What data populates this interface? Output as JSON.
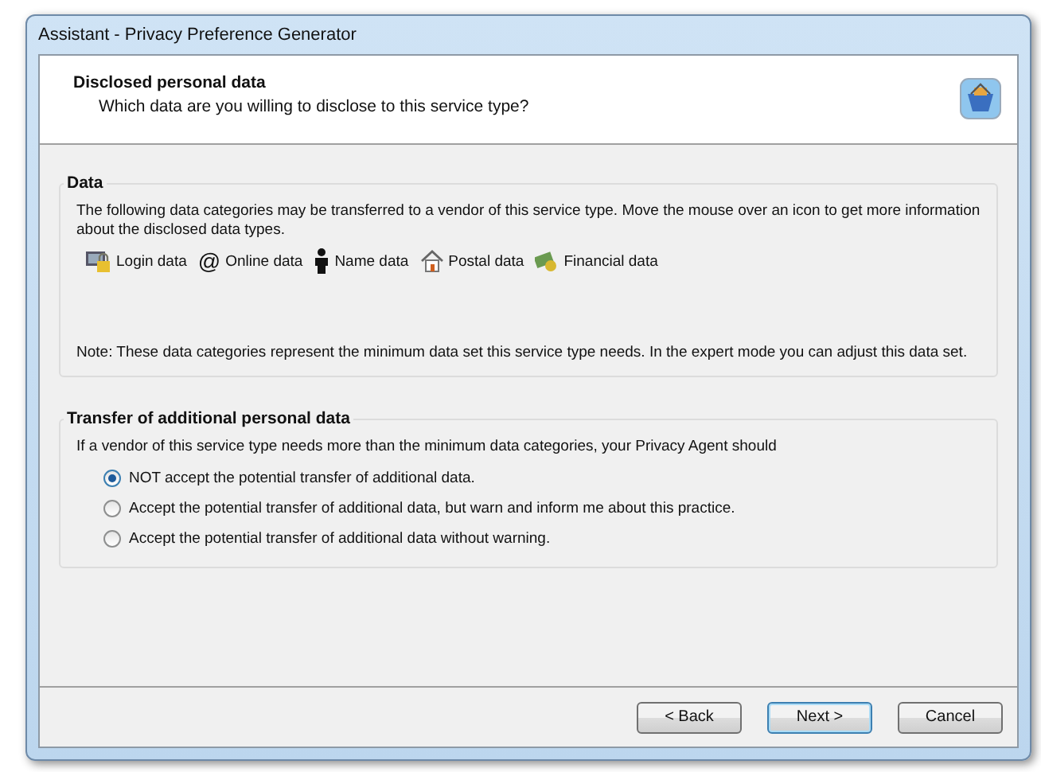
{
  "window": {
    "title": "Assistant - Privacy Preference Generator"
  },
  "header": {
    "title": "Disclosed personal data",
    "subtitle": "Which data are you willing to disclose to this service type?"
  },
  "data_group": {
    "title": "Data",
    "intro": "The following data categories may be transferred to a vendor of this service type. Move the mouse over an icon to get more information about the disclosed data types.",
    "categories": [
      {
        "kind": "login",
        "label": "Login data"
      },
      {
        "kind": "online",
        "symbol": "@",
        "label": "Online data"
      },
      {
        "kind": "name",
        "label": "Name data"
      },
      {
        "kind": "postal",
        "label": "Postal data"
      },
      {
        "kind": "financial",
        "label": "Financial data"
      }
    ],
    "note": "Note: These data categories represent the minimum data set this service type needs. In the expert mode you can adjust this data set."
  },
  "transfer_group": {
    "title": "Transfer of additional personal data",
    "intro": "If a vendor of this service type needs more than the minimum data categories, your Privacy Agent should",
    "options": [
      {
        "label": "NOT accept the potential transfer of additional data.",
        "selected": true
      },
      {
        "label": "Accept the potential transfer of additional data, but warn and inform me about this practice.",
        "selected": false
      },
      {
        "label": "Accept the potential transfer of additional data without warning.",
        "selected": false
      }
    ]
  },
  "buttons": [
    {
      "label": "< Back",
      "default": false
    },
    {
      "label": "Next >",
      "default": true
    },
    {
      "label": "Cancel",
      "default": false
    }
  ]
}
